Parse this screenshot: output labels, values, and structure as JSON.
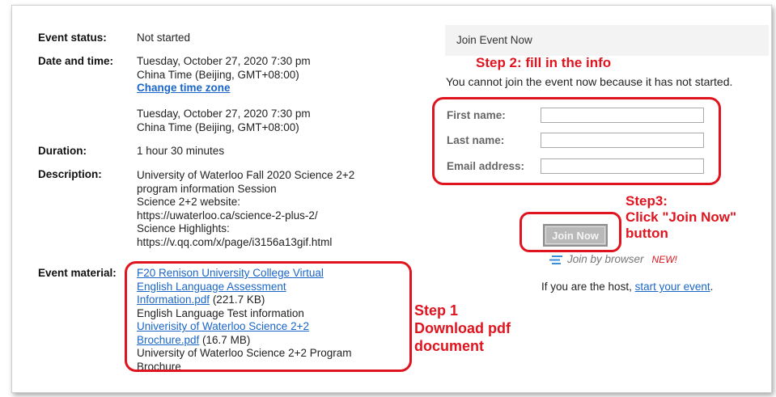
{
  "event": {
    "status_label": "Event status:",
    "status_value": "Not started",
    "datetime_label": "Date and time:",
    "datetime_line1": "Tuesday, October 27, 2020 7:30 pm",
    "datetime_line2": "China Time (Beijing, GMT+08:00)",
    "change_tz": "Change time zone",
    "datetime2_line1": "Tuesday, October 27, 2020 7:30 pm",
    "datetime2_line2": "China Time (Beijing, GMT+08:00)",
    "duration_label": "Duration:",
    "duration_value": "1 hour 30 minutes",
    "description_label": "Description:",
    "description_lines": [
      "University of Waterloo Fall 2020 Science 2+2",
      "program information Session",
      "Science 2+2 website:",
      "https://uwaterloo.ca/science-2-plus-2/",
      "Science Highlights:",
      "https://v.qq.com/x/page/i3156a13gif.html"
    ],
    "material_label": "Event material:",
    "material1_link_line1": "F20 Renison University College Virtual",
    "material1_link_line2": "English Language Assessment",
    "material1_link_line3": "Information.pdf",
    "material1_size": " (221.7 KB)",
    "material1_desc": "English Language Test information",
    "material2_link_line1": "Univerisity of Waterloo Science 2+2",
    "material2_link_line2": "Brochure.pdf",
    "material2_size": " (16.7 MB)",
    "material2_desc_line1": "University of Waterloo Science 2+2 Program",
    "material2_desc_line2": "Brochure"
  },
  "join_panel": {
    "header": "Join Event Now",
    "notice": "You cannot join the event now because it has not started.",
    "first_name_label": "First name:",
    "last_name_label": "Last name:",
    "email_label": "Email address:",
    "first_name_value": "",
    "last_name_value": "",
    "email_value": "",
    "join_button": "Join Now",
    "join_browser": "Join by browser",
    "new_badge": "NEW!",
    "host_text": "If you are the host, ",
    "host_link": "start your event",
    "host_end": "."
  },
  "annotations": {
    "step2": "Step 2: fill in the info",
    "step3_line1": "Step3:",
    "step3_line2": "Click \"Join Now\"",
    "step3_line3": "button",
    "step1_line1": "Step 1",
    "step1_line2": "Download pdf",
    "step1_line3": "document",
    "color": "#e0141e"
  }
}
